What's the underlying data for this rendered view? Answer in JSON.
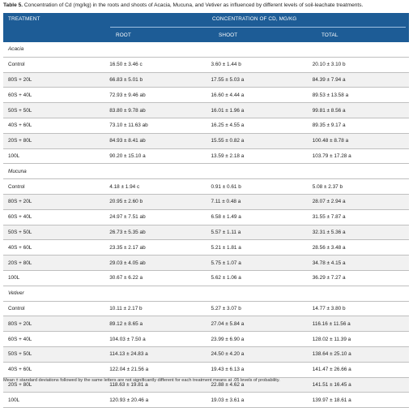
{
  "caption": {
    "label": "Table 5.",
    "text": "Concentration of Cd (mg/kg) in the roots and shoots of Acacia, Mucuna, and Vetiver as influenced by different levels of soil-leachate treatments."
  },
  "header": {
    "treatment": "TREATMENT",
    "concentration": "CONCENTRATION OF CD, MG/KG",
    "root": "ROOT",
    "shoot": "SHOOT",
    "total": "TOTAL"
  },
  "rows": [
    {
      "group": "Acacia"
    },
    {
      "t": "Control",
      "root": "16.50 ± 3.46 c",
      "shoot": "3.60 ± 1.44 b",
      "total": "20.10 ± 3.10 b"
    },
    {
      "t": "80S + 20L",
      "root": "66.83 ± 5.01 b",
      "shoot": "17.55 ± 5.03 a",
      "total": "84.39 ± 7.94 a"
    },
    {
      "t": "60S + 40L",
      "root": "72.93 ± 9.46 ab",
      "shoot": "16.60 ± 4.44 a",
      "total": "89.53 ± 13.58 a"
    },
    {
      "t": "50S + 50L",
      "root": "83.80 ± 9.78 ab",
      "shoot": "16.01 ± 1.96 a",
      "total": "99.81 ± 8.56 a"
    },
    {
      "t": "40S + 60L",
      "root": "73.10 ± 11.63 ab",
      "shoot": "16.25 ± 4.55 a",
      "total": "89.35 ± 9.17 a"
    },
    {
      "t": "20S + 80L",
      "root": "84.93 ± 8.41 ab",
      "shoot": "15.55 ± 0.82 a",
      "total": "100.48 ± 8.78 a"
    },
    {
      "t": "100L",
      "root": "90.20 ± 15.10 a",
      "shoot": "13.59 ± 2.18 a",
      "total": "103.79 ± 17.28 a"
    },
    {
      "group": "Mucuna"
    },
    {
      "t": "Control",
      "root": "4.18 ± 1.94 c",
      "shoot": "0.91 ± 0.61 b",
      "total": "5.08 ± 2.37 b"
    },
    {
      "t": "80S + 20L",
      "root": "20.95 ± 2.60 b",
      "shoot": "7.11 ± 0.48 a",
      "total": "28.07 ± 2.94 a"
    },
    {
      "t": "60S + 40L",
      "root": "24.97 ± 7.51 ab",
      "shoot": "6.58 ± 1.49 a",
      "total": "31.55 ± 7.87 a"
    },
    {
      "t": "50S + 50L",
      "root": "26.73 ± 5.35 ab",
      "shoot": "5.57 ± 1.11 a",
      "total": "32.31 ± 5.36 a"
    },
    {
      "t": "40S + 60L",
      "root": "23.35 ± 2.17 ab",
      "shoot": "5.21 ± 1.81 a",
      "total": "28.56 ± 3.48 a"
    },
    {
      "t": "20S + 80L",
      "root": "29.03 ± 4.05 ab",
      "shoot": "5.75 ± 1.07 a",
      "total": "34.78 ± 4.15 a"
    },
    {
      "t": "100L",
      "root": "30.67 ± 6.22 a",
      "shoot": "5.62 ± 1.06 a",
      "total": "36.29 ± 7.27 a"
    },
    {
      "group": "Vetiver"
    },
    {
      "t": "Control",
      "root": "10.11 ± 2.17 b",
      "shoot": "5.27 ± 3.07 b",
      "total": "14.77 ± 3.80 b"
    },
    {
      "t": "80S + 20L",
      "root": "89.12 ± 8.65 a",
      "shoot": "27.04 ± 5.84 a",
      "total": "116.16 ± 11.56 a"
    },
    {
      "t": "60S + 40L",
      "root": "104.03 ± 7.50 a",
      "shoot": "23.99 ± 6.90 a",
      "total": "128.02 ± 11.39 a"
    },
    {
      "t": "50S + 50L",
      "root": "114.13 ± 24.83 a",
      "shoot": "24.50 ± 4.20 a",
      "total": "138.64 ± 25.10 a"
    },
    {
      "t": "40S + 60L",
      "root": "122.04 ± 21.56 a",
      "shoot": "19.43 ± 6.13 a",
      "total": "141.47 ± 26.66 a"
    },
    {
      "t": "20S + 80L",
      "root": "118.63 ± 19.81 a",
      "shoot": "22.88 ± 4.62 a",
      "total": "141.51 ± 16.45 a"
    },
    {
      "t": "100L",
      "root": "120.93 ± 20.46 a",
      "shoot": "19.03 ± 3.61 a",
      "total": "139.97 ± 18.61 a"
    }
  ],
  "footnote": "Mean ± standard deviations followed by the same letters are not significantly different for each treatment means at .05 levels of probability.",
  "colors": {
    "header_bg": "#1d5c96",
    "row_alt": "#f1f1f1",
    "rule": "#bfbfbf"
  }
}
